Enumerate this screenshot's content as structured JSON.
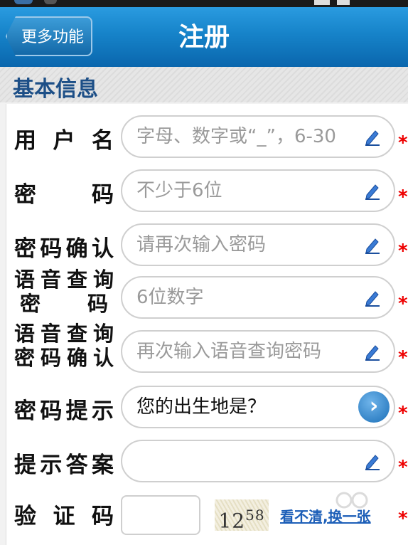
{
  "header": {
    "back_label": "更多功能",
    "title": "注册"
  },
  "section": {
    "title": "基本信息"
  },
  "form": {
    "fields": [
      {
        "label": "用户名",
        "placeholder": "字母、数字或“_”，6-30",
        "value": "",
        "icon": "pencil-icon",
        "required": "*"
      },
      {
        "label": "密码",
        "placeholder": "不少于6位",
        "value": "",
        "icon": "pencil-icon",
        "required": "*"
      },
      {
        "label": "密码确认",
        "placeholder": "请再次输入密码",
        "value": "",
        "icon": "pencil-icon",
        "required": "*"
      },
      {
        "label_line1": "语音查询",
        "label_line2": "密码",
        "placeholder": "6位数字",
        "value": "",
        "icon": "pencil-icon",
        "required": "*"
      },
      {
        "label_line1": "语音查询",
        "label_line2": "密码确认",
        "placeholder": "再次输入语音查询密码",
        "value": "",
        "icon": "pencil-icon",
        "required": "*"
      },
      {
        "label": "密码提示",
        "value": "您的出生地是？",
        "icon": "chevron-right-icon",
        "required": "*"
      },
      {
        "label": "提示答案",
        "placeholder": "",
        "value": "",
        "icon": "pencil-icon",
        "required": "*"
      }
    ],
    "captcha": {
      "label": "验证码",
      "value": "",
      "image_text_main": "12",
      "image_text_sup": "58",
      "refresh_label": "看不清,换一张",
      "required": "*"
    }
  },
  "colors": {
    "titlebar": "#1683c9",
    "section_title": "#1d4f87",
    "required": "#e00000",
    "link": "#1d5fb8"
  }
}
